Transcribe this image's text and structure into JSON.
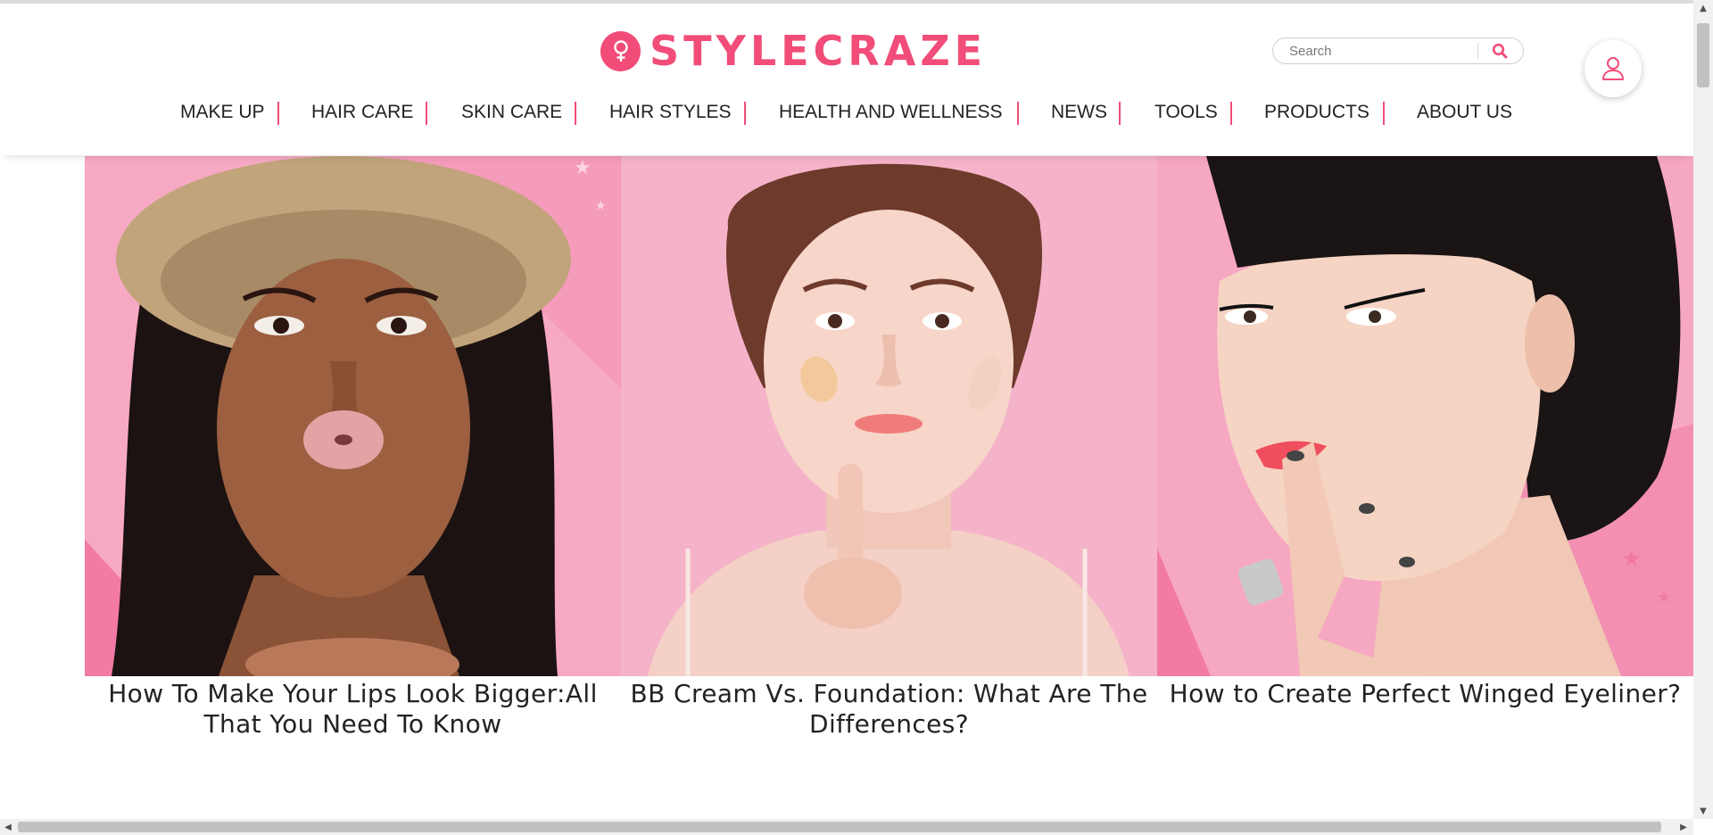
{
  "header": {
    "logo_text": "STYLECRAZE",
    "search": {
      "placeholder": "Search",
      "value": ""
    },
    "icons": {
      "logo": "female-symbol-icon",
      "search": "search-icon",
      "account": "user-icon"
    }
  },
  "nav": {
    "items": [
      {
        "label": "MAKE UP"
      },
      {
        "label": "HAIR CARE"
      },
      {
        "label": "SKIN CARE"
      },
      {
        "label": "HAIR STYLES"
      },
      {
        "label": "HEALTH AND WELLNESS"
      },
      {
        "label": "NEWS"
      },
      {
        "label": "TOOLS"
      },
      {
        "label": "PRODUCTS"
      },
      {
        "label": "ABOUT US"
      }
    ]
  },
  "articles": [
    {
      "title": "How To Make Your Lips Look Bigger:All That You Need To Know"
    },
    {
      "title": "BB Cream Vs. Foundation: What Are The Differences?"
    },
    {
      "title": "How to Create Perfect Winged Eyeliner?"
    }
  ],
  "theme": {
    "brand_color": "#f14d78",
    "background_pink": "#f7a4c0",
    "text_color": "#222222"
  }
}
